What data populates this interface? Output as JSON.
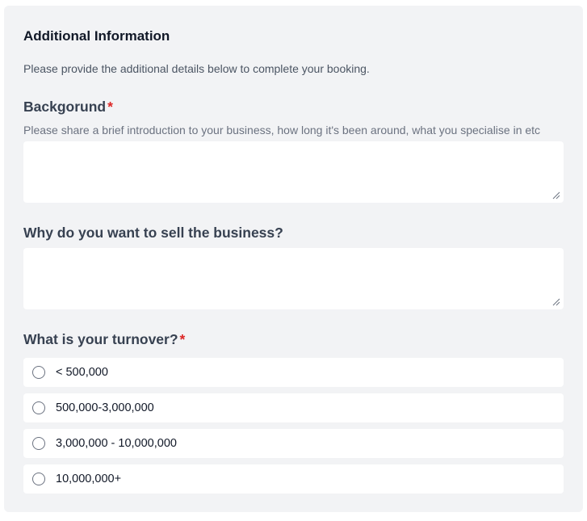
{
  "section": {
    "title": "Additional Information",
    "description": "Please provide the additional details below to complete your booking."
  },
  "background_field": {
    "label": "Backgorund",
    "required_marker": "*",
    "hint": "Please share a brief introduction to your business, how long it's been around, what you specialise in etc",
    "value": ""
  },
  "reason_field": {
    "label": "Why do you want to sell the business?",
    "value": ""
  },
  "turnover_field": {
    "label": "What is your turnover?",
    "required_marker": "*",
    "options": [
      {
        "label": "< 500,000",
        "selected": false
      },
      {
        "label": "500,000-3,000,000",
        "selected": false
      },
      {
        "label": "3,000,000 - 10,000,000",
        "selected": false
      },
      {
        "label": "10,000,000+",
        "selected": false
      }
    ]
  },
  "colors": {
    "panel_background": "#f2f3f5",
    "required_marker": "#dc2626",
    "field_background": "#ffffff"
  },
  "icons": {
    "resize_handle": "resize-grip-icon",
    "radio": "radio-unchecked-icon"
  }
}
